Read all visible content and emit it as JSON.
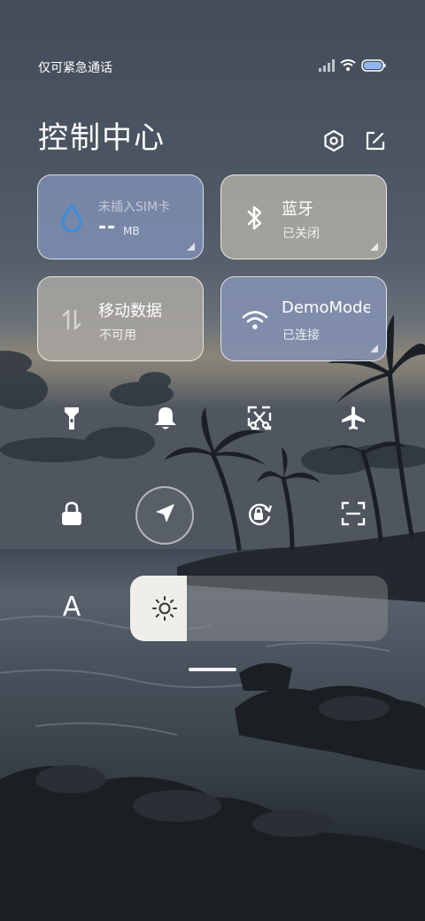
{
  "status_bar": {
    "carrier_text": "仅可紧急通话",
    "icons": [
      "signal-icon",
      "wifi-icon",
      "battery-icon"
    ]
  },
  "header": {
    "title": "控制中心",
    "settings_icon": "gear-icon",
    "edit_icon": "edit-icon"
  },
  "tiles": {
    "sim": {
      "label": "未插入SIM卡",
      "value": "--",
      "unit": "MB",
      "icon": "water-drop-icon"
    },
    "bluetooth": {
      "label": "蓝牙",
      "status": "已关闭",
      "icon": "bluetooth-icon"
    },
    "mobile_data": {
      "label": "移动数据",
      "status": "不可用",
      "icon": "data-arrows-icon"
    },
    "wifi": {
      "label": "DemoMode",
      "status": "已连接",
      "icon": "wifi-icon"
    }
  },
  "toggles": [
    {
      "name": "flashlight",
      "icon": "flashlight-icon"
    },
    {
      "name": "ringer",
      "icon": "bell-icon"
    },
    {
      "name": "screenshot",
      "icon": "scissors-screenshot-icon"
    },
    {
      "name": "airplane",
      "icon": "airplane-icon"
    },
    {
      "name": "lock-screen",
      "icon": "lock-icon"
    },
    {
      "name": "location",
      "icon": "location-arrow-icon"
    },
    {
      "name": "rotation-lock",
      "icon": "rotation-lock-icon"
    },
    {
      "name": "scanner",
      "icon": "scan-icon"
    }
  ],
  "brightness": {
    "auto_label": "A",
    "level_fraction": 0.22,
    "icon": "sun-icon"
  },
  "colors": {
    "sim_tile": "#7d8caf",
    "bluetooth_tile": "#aaa7a0",
    "mobile_tile": "#a8a5a0",
    "wifi_tile": "#828faf",
    "accent_blue": "#2f8fe6"
  }
}
